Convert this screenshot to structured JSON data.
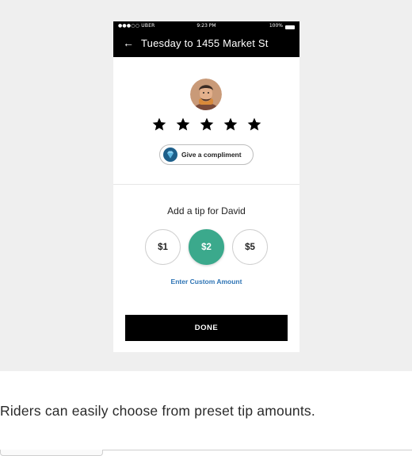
{
  "status_bar": {
    "carrier": "●●●○○ UBER",
    "time": "9:23 PM",
    "battery": "100%"
  },
  "navbar": {
    "back_icon": "←",
    "title": "Tuesday to 1455 Market St"
  },
  "rating": {
    "stars": 5,
    "star_color": "#000000"
  },
  "compliment": {
    "label": "Give a compliment",
    "icon": "diamond-icon"
  },
  "tip": {
    "title": "Add a tip for David",
    "options": [
      "$1",
      "$2",
      "$5"
    ],
    "selected": "$2",
    "accent_color": "#3ba98c",
    "custom_label": "Enter Custom Amount"
  },
  "done_label": "DONE",
  "caption": "Riders can easily choose from preset tip amounts."
}
